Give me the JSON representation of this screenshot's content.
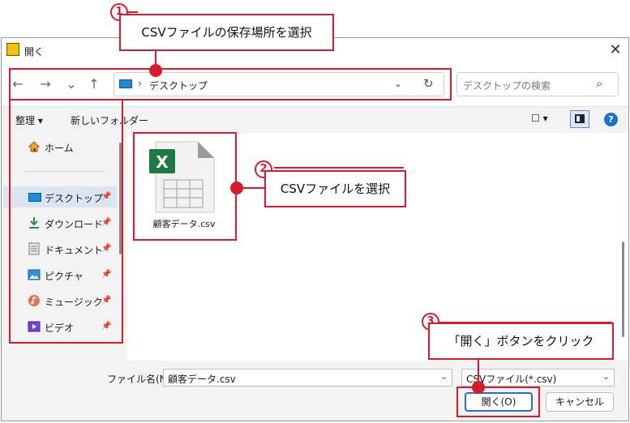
{
  "window": {
    "title": "開く",
    "close_glyph": "✕"
  },
  "nav": {
    "back": "←",
    "forward": "→",
    "recent": "⌄",
    "up": "↑",
    "address_separator": "›",
    "address": "デスクトップ",
    "address_dropdown": "⌄",
    "refresh": "↻",
    "search_placeholder": "デスクトップの検索",
    "search_glyph": "⌕"
  },
  "toolbar": {
    "organize": "整理 ▾",
    "new_folder": "新しいフォルダー",
    "view_glyph": "☐ ▾",
    "help_glyph": "?"
  },
  "sidebar": {
    "items": [
      {
        "label": "ホーム",
        "icon": "home-icon",
        "pinned": false
      },
      {
        "label": "デスクトップ",
        "icon": "desktop-icon",
        "pinned": true
      },
      {
        "label": "ダウンロード",
        "icon": "download-icon",
        "pinned": true
      },
      {
        "label": "ドキュメント",
        "icon": "document-icon",
        "pinned": true
      },
      {
        "label": "ピクチャ",
        "icon": "picture-icon",
        "pinned": true
      },
      {
        "label": "ミュージック",
        "icon": "music-icon",
        "pinned": true
      },
      {
        "label": "ビデオ",
        "icon": "video-icon",
        "pinned": true
      }
    ],
    "pin_glyph": "📌"
  },
  "files": [
    {
      "name": "顧客データ.csv",
      "icon": "excel-csv-icon",
      "badge": "X"
    }
  ],
  "bottom": {
    "filename_label": "ファイル名(N):",
    "filename_value": "顧客データ.csv",
    "filetype_value": "CSVファイル(*.csv)",
    "dropdown_glyph": "⌄",
    "open_button": "開く(O)",
    "cancel_button": "キャンセル"
  },
  "annotations": {
    "step1_num": "1",
    "step1_text": "CSVファイルの保存場所を選択",
    "step2_num": "2",
    "step2_text": "CSVファイルを選択",
    "step3_num": "3",
    "step3_text": "「開く」ボタンをクリック"
  },
  "colors": {
    "annotation_red": "#d61c2c",
    "accent_blue": "#2b6fc4",
    "excel_green": "#1e7a43"
  }
}
